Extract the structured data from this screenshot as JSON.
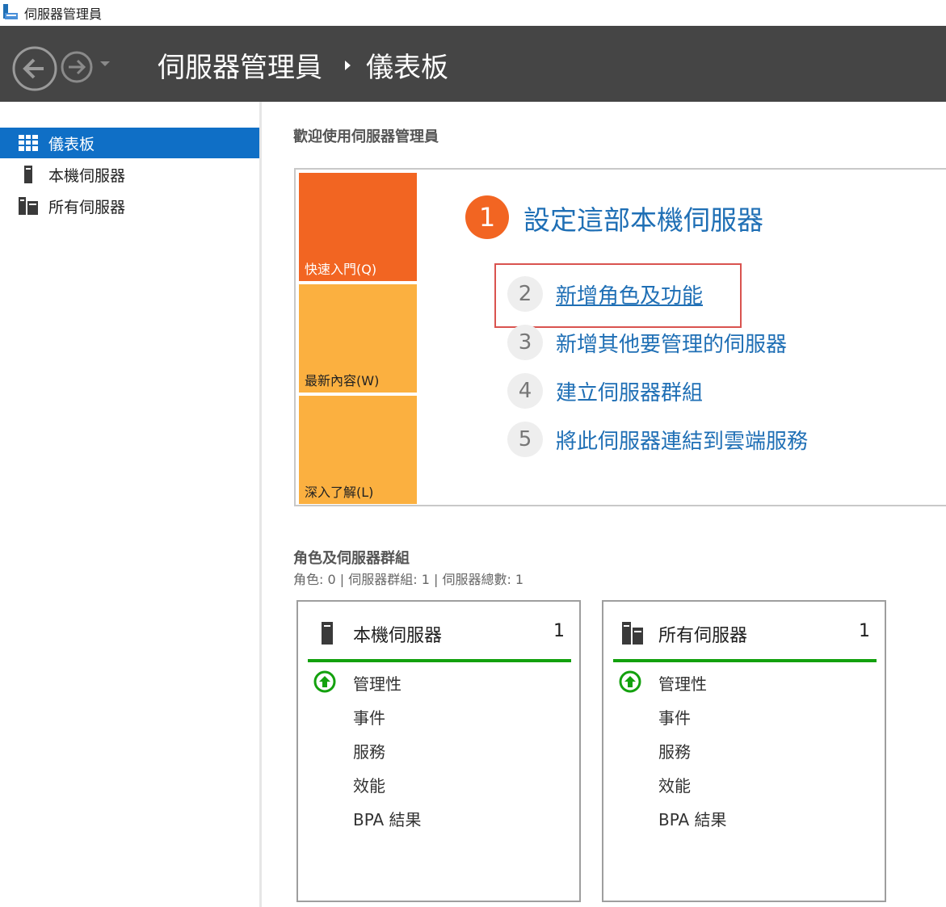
{
  "window": {
    "title": "伺服器管理員"
  },
  "header": {
    "app": "伺服器管理員",
    "page": "儀表板"
  },
  "sidebar": {
    "items": [
      {
        "label": "儀表板",
        "icon": "dashboard-icon",
        "active": true
      },
      {
        "label": "本機伺服器",
        "icon": "server-icon",
        "active": false
      },
      {
        "label": "所有伺服器",
        "icon": "servers-icon",
        "active": false
      }
    ]
  },
  "main": {
    "welcome": "歡迎使用伺服器管理員",
    "tiles": [
      {
        "label": "快速入門(Q)",
        "color": "#f26522"
      },
      {
        "label": "最新內容(W)",
        "color": "#fbb040"
      },
      {
        "label": "深入了解(L)",
        "color": "#fbb040"
      }
    ],
    "step1": {
      "num": "1",
      "title": "設定這部本機伺服器"
    },
    "steps": [
      {
        "num": "2",
        "label": "新增角色及功能"
      },
      {
        "num": "3",
        "label": "新增其他要管理的伺服器"
      },
      {
        "num": "4",
        "label": "建立伺服器群組"
      },
      {
        "num": "5",
        "label": "將此伺服器連結到雲端服務"
      }
    ],
    "roles_title": "角色及伺服器群組",
    "roles_sub": "角色: 0 | 伺服器群組: 1 | 伺服器總數: 1",
    "cards": [
      {
        "title": "本機伺服器",
        "count": "1",
        "rows": [
          "管理性",
          "事件",
          "服務",
          "效能",
          "BPA 結果"
        ]
      },
      {
        "title": "所有伺服器",
        "count": "1",
        "rows": [
          "管理性",
          "事件",
          "服務",
          "效能",
          "BPA 結果"
        ]
      }
    ]
  },
  "colors": {
    "accent": "#0f6fc6",
    "header": "#454545",
    "link": "#1f6fb5",
    "ok": "#13a10e",
    "highlight": "#d9534f"
  }
}
